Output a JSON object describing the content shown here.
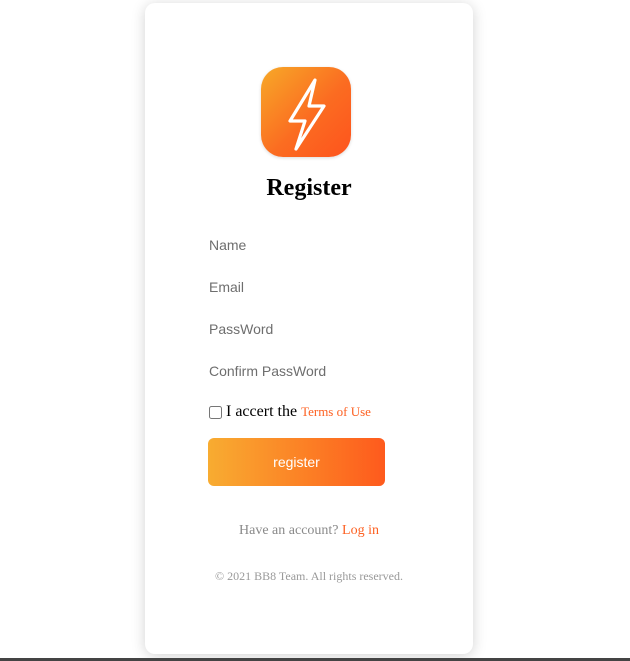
{
  "register": {
    "logo_icon": "lightning-bolt-icon",
    "title": "Register",
    "fields": {
      "name_placeholder": "Name",
      "email_placeholder": "Email",
      "password_placeholder": "PassWord",
      "confirm_placeholder": "Confirm PassWord"
    },
    "terms": {
      "prefix": "I accert the",
      "link": "Terms of Use",
      "checked": false
    },
    "button_label": "register",
    "account_prompt": "Have an account?",
    "login_link": "Log in",
    "copyright": "© 2021 BB8 Team. All rights reserved."
  },
  "colors": {
    "accent": "#fd6021",
    "gradient_start": "#f8ac31",
    "gradient_end": "#fe5a1d"
  }
}
